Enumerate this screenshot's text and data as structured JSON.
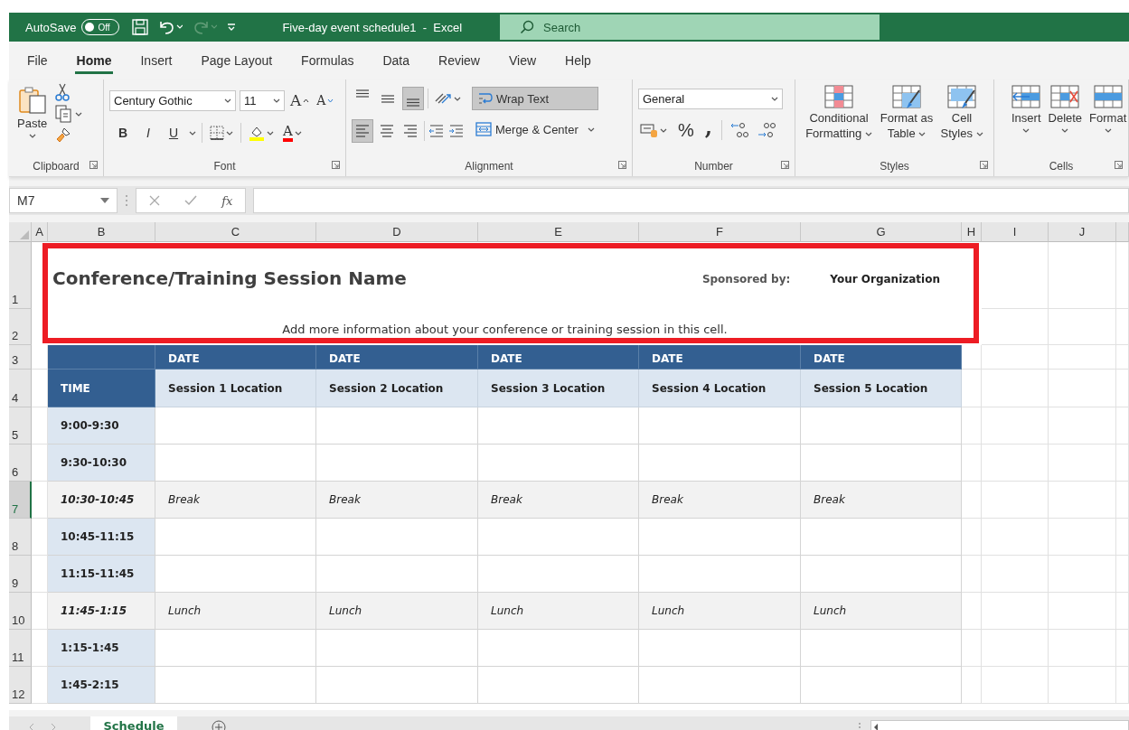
{
  "title_bar": {
    "autosave": {
      "label": "AutoSave",
      "state_text": "Off",
      "on": false
    },
    "document_title": "Five-day event schedule1  -  Excel",
    "search": {
      "placeholder": "Search"
    }
  },
  "menu_tabs": [
    {
      "label": "File",
      "selected": false
    },
    {
      "label": "Home",
      "selected": true
    },
    {
      "label": "Insert",
      "selected": false
    },
    {
      "label": "Page Layout",
      "selected": false
    },
    {
      "label": "Formulas",
      "selected": false
    },
    {
      "label": "Data",
      "selected": false
    },
    {
      "label": "Review",
      "selected": false
    },
    {
      "label": "View",
      "selected": false
    },
    {
      "label": "Help",
      "selected": false
    }
  ],
  "ribbon": {
    "clipboard": {
      "label": "Clipboard",
      "paste": "Paste"
    },
    "font": {
      "label": "Font",
      "font_name": "Century Gothic",
      "font_size": "11",
      "size_buttons": [
        "A",
        "A"
      ],
      "style_buttons": [
        "B",
        "I",
        "U"
      ],
      "font_color_letter": "A"
    },
    "alignment": {
      "label": "Alignment",
      "vertical": [
        {
          "selected": false
        },
        {
          "selected": false
        },
        {
          "selected": true
        }
      ],
      "horizontal": [
        {
          "selected": true
        },
        {
          "selected": false
        },
        {
          "selected": false
        }
      ],
      "wrap_text": {
        "label": "Wrap Text",
        "selected": true
      },
      "merge": {
        "label": "Merge & Center",
        "selected": false
      }
    },
    "number": {
      "label": "Number",
      "format": "General",
      "percent": "%",
      "comma": ","
    },
    "styles": {
      "label": "Styles",
      "buttons": [
        "Conditional Formatting",
        "Format as Table",
        "Cell Styles"
      ]
    },
    "cells": {
      "label": "Cells",
      "buttons": [
        "Insert",
        "Delete",
        "Format"
      ]
    }
  },
  "formula_bar": {
    "name_box": "M7",
    "function_label": "fx"
  },
  "columns": [
    "A",
    "B",
    "C",
    "D",
    "E",
    "F",
    "G",
    "H",
    "I",
    "J"
  ],
  "rows": [
    {
      "label": "1",
      "selected": false
    },
    {
      "label": "2",
      "selected": false
    },
    {
      "label": "3",
      "selected": false
    },
    {
      "label": "4",
      "selected": false
    },
    {
      "label": "5",
      "selected": false
    },
    {
      "label": "6",
      "selected": false
    },
    {
      "label": "7",
      "selected": true
    },
    {
      "label": "8",
      "selected": false
    },
    {
      "label": "9",
      "selected": false
    },
    {
      "label": "10",
      "selected": false
    },
    {
      "label": "11",
      "selected": false
    },
    {
      "label": "12",
      "selected": false
    }
  ],
  "header": {
    "title": "Conference/Training Session Name",
    "sponsored_label": "Sponsored by:",
    "sponsor": "Your Organization",
    "info": "Add more information about your conference or training session in this cell.",
    "highlighted": true
  },
  "schedule": {
    "time_header": "TIME",
    "dates": [
      "DATE",
      "DATE",
      "DATE",
      "DATE",
      "DATE"
    ],
    "locations": [
      "Session 1 Location",
      "Session 2 Location",
      "Session 3 Location",
      "Session 4 Location",
      "Session 5 Location"
    ],
    "slots": [
      {
        "time": "9:00-9:30",
        "kind": "session"
      },
      {
        "time": "9:30-10:30",
        "kind": "session"
      },
      {
        "time": "10:30-10:45",
        "kind": "break",
        "cells": [
          "Break",
          "Break",
          "Break",
          "Break",
          "Break"
        ]
      },
      {
        "time": "10:45-11:15",
        "kind": "session"
      },
      {
        "time": "11:15-11:45",
        "kind": "session"
      },
      {
        "time": "11:45-1:15",
        "kind": "break",
        "cells": [
          "Lunch",
          "Lunch",
          "Lunch",
          "Lunch",
          "Lunch"
        ]
      },
      {
        "time": "1:15-1:45",
        "kind": "session"
      },
      {
        "time": "1:45-2:15",
        "kind": "session"
      }
    ]
  },
  "sheet_tabs": [
    {
      "label": "Schedule",
      "selected": true
    }
  ]
}
